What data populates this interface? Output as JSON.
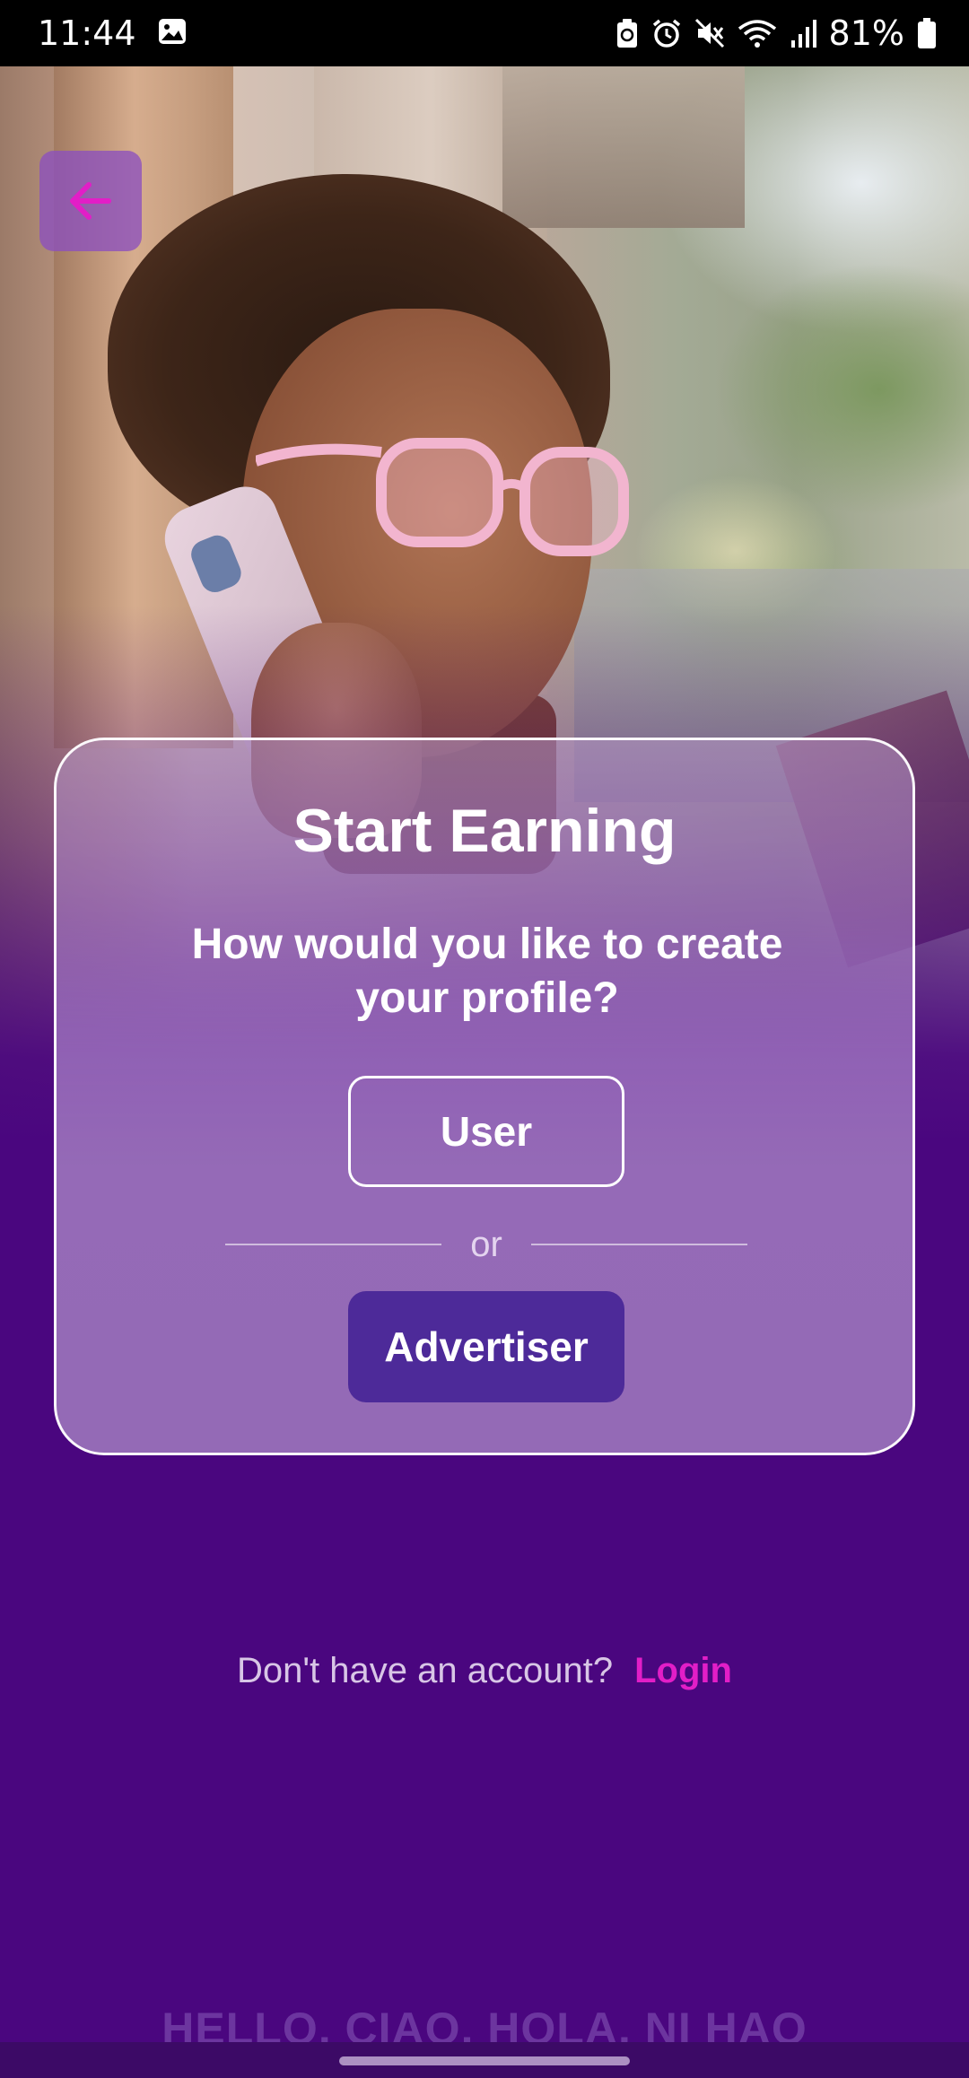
{
  "status_bar": {
    "time": "11:44",
    "battery_percent": "81%",
    "icons": [
      "gallery-icon",
      "battery-saver-icon",
      "alarm-icon",
      "mute-icon",
      "wifi-icon",
      "signal-icon",
      "battery-icon"
    ]
  },
  "back_button": {
    "icon": "arrow-left-icon",
    "color": "#e21ec7"
  },
  "card": {
    "title": "Start Earning",
    "subtitle": "How would you like to create your profile?",
    "user_button_label": "User",
    "or_label": "or",
    "advertiser_button_label": "Advertiser"
  },
  "footer": {
    "prompt": "Don't have an account?",
    "login_label": "Login",
    "marquee": "HELLO, CIAO, HOLA, NI HAO"
  },
  "colors": {
    "background": "#4a067f",
    "accent": "#e21ec7",
    "primary_button": "#4d2a99"
  }
}
